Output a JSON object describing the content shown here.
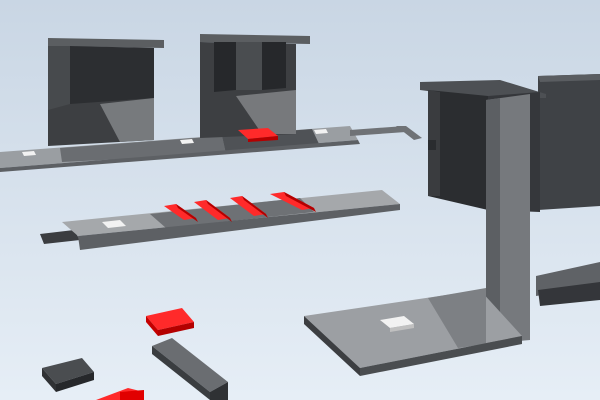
{
  "scene": {
    "sky_top": "#c9d6e4",
    "sky_bottom": "#e6eef6",
    "colors": {
      "block_dark": "#2a2c2f",
      "block_face": "#3f4144",
      "block_mid": "#55585b",
      "block_light": "#6c6f72",
      "platform_top": "#8c8f93",
      "platform_light": "#a7aaad",
      "platform_side": "#5d6064",
      "rail": "#6f7276",
      "red_top": "#ff2a2a",
      "red_side": "#b40000",
      "white_marker": "#f2f2f2",
      "white_side": "#bfbfbf"
    },
    "objects": [
      "rear-platform",
      "rear-tower-left",
      "rear-tower-right",
      "rear-red-pad",
      "rear-white-markers",
      "rear-rail",
      "mid-platform",
      "mid-red-bars",
      "mid-white-marker",
      "right-large-structure",
      "right-base-platform",
      "right-white-marker",
      "foreground-red-blocks",
      "foreground-dark-blocks"
    ]
  }
}
